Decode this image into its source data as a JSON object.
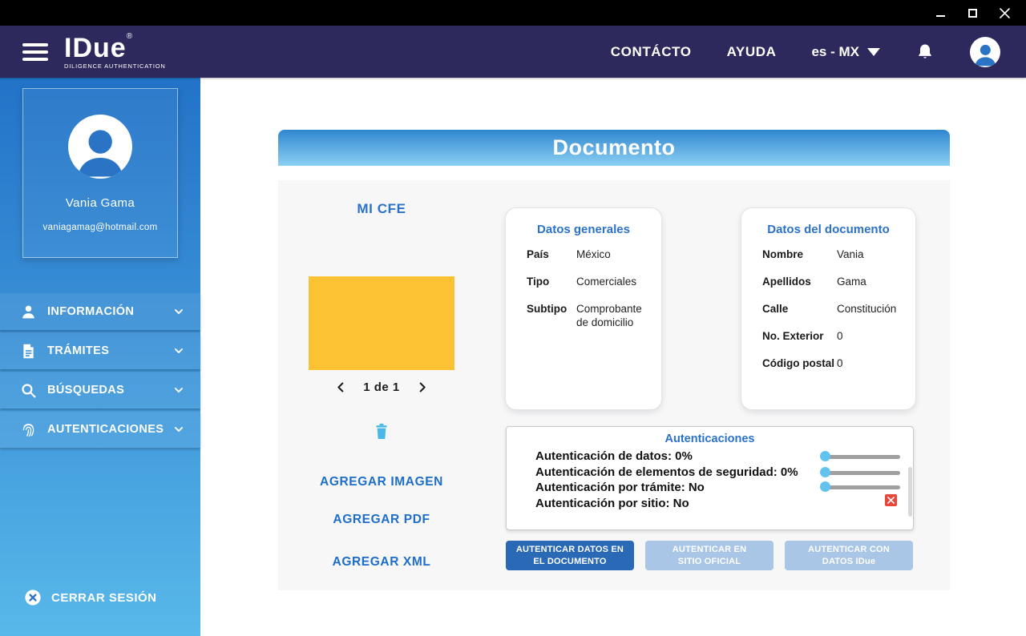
{
  "window": {
    "controls": [
      {
        "name": "minimize"
      },
      {
        "name": "maximize"
      },
      {
        "name": "close"
      }
    ]
  },
  "header": {
    "logo": {
      "title": "IDue",
      "reg": "®",
      "subtitle": "DILIGENCE AUTHENTICATION"
    },
    "nav": [
      {
        "label": "CONTÁCTO"
      },
      {
        "label": "AYUDA"
      }
    ],
    "language": {
      "label": "es - MX"
    }
  },
  "sidebar": {
    "profile": {
      "name": "Vania Gama",
      "email": "vaniagamag@hotmail.com"
    },
    "menu": [
      {
        "label": "INFORMACIÓN",
        "icon": "user-icon"
      },
      {
        "label": "TRÁMITES",
        "icon": "document-icon"
      },
      {
        "label": "BÚSQUEDAS",
        "icon": "search-icon"
      },
      {
        "label": "AUTENTICACIONES",
        "icon": "fingerprint-icon"
      }
    ],
    "logout_label": "CERRAR SESIÓN"
  },
  "main": {
    "title": "Documento",
    "doc": {
      "name": "MI CFE",
      "pagination": "1 de 1",
      "actions": [
        {
          "label": "AGREGAR IMAGEN"
        },
        {
          "label": "AGREGAR PDF"
        },
        {
          "label": "AGREGAR XML"
        }
      ]
    },
    "datos_generales": {
      "title": "Datos generales",
      "rows": [
        {
          "label": "País",
          "value": "México"
        },
        {
          "label": "Tipo",
          "value": "Comerciales"
        },
        {
          "label": "Subtipo",
          "value": "Comprobante de domicilio"
        }
      ]
    },
    "datos_documento": {
      "title": "Datos del documento",
      "rows": [
        {
          "label": "Nombre",
          "value": "Vania"
        },
        {
          "label": "Apellidos",
          "value": "Gama"
        },
        {
          "label": "Calle",
          "value": "Constitución"
        },
        {
          "label": "No. Exterior",
          "value": "0"
        },
        {
          "label": "Código postal",
          "value": "0"
        }
      ]
    },
    "autenticaciones": {
      "title": "Autenticaciones",
      "items": [
        {
          "label": "Autenticación de datos: 0%",
          "slider_value": 0
        },
        {
          "label": "Autenticación de elementos de seguridad: 0%",
          "slider_value": 0
        },
        {
          "label": "Autenticación por trámite: No",
          "slider_value": 0
        },
        {
          "label": "Autenticación por sitio: No",
          "status": "error"
        }
      ]
    },
    "buttons": [
      {
        "label": "AUTENTICAR DATOS EN EL DOCUMENTO",
        "style": "primary"
      },
      {
        "label": "AUTENTICAR EN SITIO OFICIAL",
        "style": "secondary"
      },
      {
        "label": "AUTENTICAR CON DATOS IDue",
        "style": "secondary"
      }
    ]
  },
  "colors": {
    "header_bg": "#2e295c",
    "sidebar_gradient_top": "#2273c8",
    "sidebar_gradient_bottom": "#58b8e9",
    "accent_blue": "#2b72c8",
    "link_blue": "#1e6ec9",
    "light_blue": "#49b8e8",
    "doc_preview_yellow": "#fbc233",
    "button_primary": "#2a69b5",
    "button_secondary": "#a9c6e6",
    "error_red": "#e8473a"
  }
}
